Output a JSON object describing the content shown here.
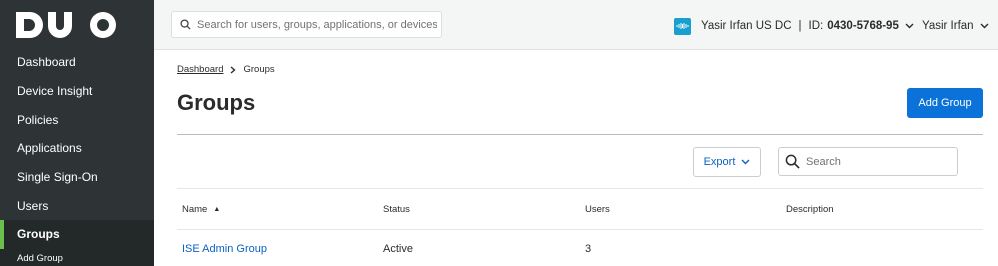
{
  "brand": {
    "logo_text": "DUO",
    "accent_color": "#6bc04b",
    "sidebar_bg": "#2e3435",
    "primary_button_color": "#0b72d9"
  },
  "sidebar": {
    "items": [
      {
        "label": "Dashboard"
      },
      {
        "label": "Device Insight"
      },
      {
        "label": "Policies"
      },
      {
        "label": "Applications"
      },
      {
        "label": "Single Sign-On"
      },
      {
        "label": "Users"
      },
      {
        "label": "Groups",
        "active": true
      }
    ],
    "subitems": [
      {
        "label": "Add Group"
      }
    ]
  },
  "topbar": {
    "search_placeholder": "Search for users, groups, applications, or devices",
    "account_name": "Yasir Irfan US DC",
    "separator": "|",
    "id_label": "ID:",
    "id_value": "0430-5768-95",
    "user_name": "Yasir Irfan"
  },
  "breadcrumb": {
    "parent": "Dashboard",
    "current": "Groups"
  },
  "page": {
    "title": "Groups",
    "add_button": "Add Group"
  },
  "toolbar": {
    "export_label": "Export",
    "search_placeholder": "Search"
  },
  "table": {
    "columns": [
      "Name",
      "Status",
      "Users",
      "Description"
    ],
    "sorted_column": "Name",
    "sort_direction": "ascending",
    "rows": [
      {
        "name": "ISE Admin Group",
        "status": "Active",
        "users": "3",
        "description": ""
      }
    ]
  }
}
